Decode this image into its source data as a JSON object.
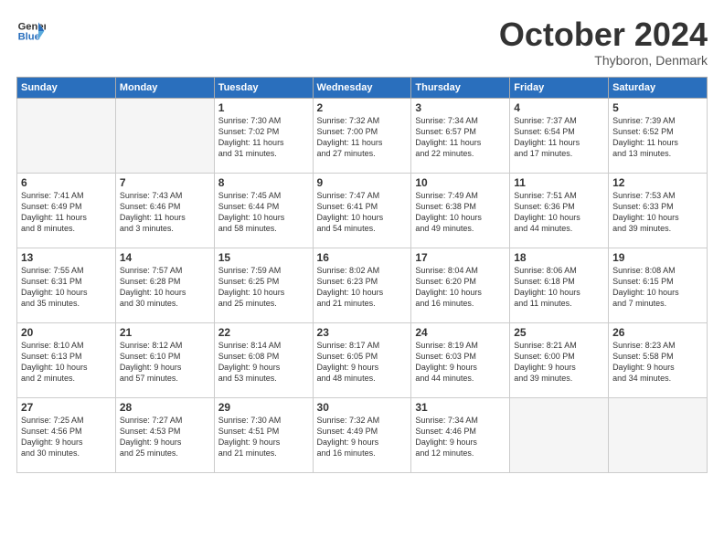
{
  "header": {
    "logo_line1": "General",
    "logo_line2": "Blue",
    "month": "October 2024",
    "location": "Thyboron, Denmark"
  },
  "weekdays": [
    "Sunday",
    "Monday",
    "Tuesday",
    "Wednesday",
    "Thursday",
    "Friday",
    "Saturday"
  ],
  "weeks": [
    [
      {
        "day": "",
        "info": ""
      },
      {
        "day": "",
        "info": ""
      },
      {
        "day": "1",
        "info": "Sunrise: 7:30 AM\nSunset: 7:02 PM\nDaylight: 11 hours\nand 31 minutes."
      },
      {
        "day": "2",
        "info": "Sunrise: 7:32 AM\nSunset: 7:00 PM\nDaylight: 11 hours\nand 27 minutes."
      },
      {
        "day": "3",
        "info": "Sunrise: 7:34 AM\nSunset: 6:57 PM\nDaylight: 11 hours\nand 22 minutes."
      },
      {
        "day": "4",
        "info": "Sunrise: 7:37 AM\nSunset: 6:54 PM\nDaylight: 11 hours\nand 17 minutes."
      },
      {
        "day": "5",
        "info": "Sunrise: 7:39 AM\nSunset: 6:52 PM\nDaylight: 11 hours\nand 13 minutes."
      }
    ],
    [
      {
        "day": "6",
        "info": "Sunrise: 7:41 AM\nSunset: 6:49 PM\nDaylight: 11 hours\nand 8 minutes."
      },
      {
        "day": "7",
        "info": "Sunrise: 7:43 AM\nSunset: 6:46 PM\nDaylight: 11 hours\nand 3 minutes."
      },
      {
        "day": "8",
        "info": "Sunrise: 7:45 AM\nSunset: 6:44 PM\nDaylight: 10 hours\nand 58 minutes."
      },
      {
        "day": "9",
        "info": "Sunrise: 7:47 AM\nSunset: 6:41 PM\nDaylight: 10 hours\nand 54 minutes."
      },
      {
        "day": "10",
        "info": "Sunrise: 7:49 AM\nSunset: 6:38 PM\nDaylight: 10 hours\nand 49 minutes."
      },
      {
        "day": "11",
        "info": "Sunrise: 7:51 AM\nSunset: 6:36 PM\nDaylight: 10 hours\nand 44 minutes."
      },
      {
        "day": "12",
        "info": "Sunrise: 7:53 AM\nSunset: 6:33 PM\nDaylight: 10 hours\nand 39 minutes."
      }
    ],
    [
      {
        "day": "13",
        "info": "Sunrise: 7:55 AM\nSunset: 6:31 PM\nDaylight: 10 hours\nand 35 minutes."
      },
      {
        "day": "14",
        "info": "Sunrise: 7:57 AM\nSunset: 6:28 PM\nDaylight: 10 hours\nand 30 minutes."
      },
      {
        "day": "15",
        "info": "Sunrise: 7:59 AM\nSunset: 6:25 PM\nDaylight: 10 hours\nand 25 minutes."
      },
      {
        "day": "16",
        "info": "Sunrise: 8:02 AM\nSunset: 6:23 PM\nDaylight: 10 hours\nand 21 minutes."
      },
      {
        "day": "17",
        "info": "Sunrise: 8:04 AM\nSunset: 6:20 PM\nDaylight: 10 hours\nand 16 minutes."
      },
      {
        "day": "18",
        "info": "Sunrise: 8:06 AM\nSunset: 6:18 PM\nDaylight: 10 hours\nand 11 minutes."
      },
      {
        "day": "19",
        "info": "Sunrise: 8:08 AM\nSunset: 6:15 PM\nDaylight: 10 hours\nand 7 minutes."
      }
    ],
    [
      {
        "day": "20",
        "info": "Sunrise: 8:10 AM\nSunset: 6:13 PM\nDaylight: 10 hours\nand 2 minutes."
      },
      {
        "day": "21",
        "info": "Sunrise: 8:12 AM\nSunset: 6:10 PM\nDaylight: 9 hours\nand 57 minutes."
      },
      {
        "day": "22",
        "info": "Sunrise: 8:14 AM\nSunset: 6:08 PM\nDaylight: 9 hours\nand 53 minutes."
      },
      {
        "day": "23",
        "info": "Sunrise: 8:17 AM\nSunset: 6:05 PM\nDaylight: 9 hours\nand 48 minutes."
      },
      {
        "day": "24",
        "info": "Sunrise: 8:19 AM\nSunset: 6:03 PM\nDaylight: 9 hours\nand 44 minutes."
      },
      {
        "day": "25",
        "info": "Sunrise: 8:21 AM\nSunset: 6:00 PM\nDaylight: 9 hours\nand 39 minutes."
      },
      {
        "day": "26",
        "info": "Sunrise: 8:23 AM\nSunset: 5:58 PM\nDaylight: 9 hours\nand 34 minutes."
      }
    ],
    [
      {
        "day": "27",
        "info": "Sunrise: 7:25 AM\nSunset: 4:56 PM\nDaylight: 9 hours\nand 30 minutes."
      },
      {
        "day": "28",
        "info": "Sunrise: 7:27 AM\nSunset: 4:53 PM\nDaylight: 9 hours\nand 25 minutes."
      },
      {
        "day": "29",
        "info": "Sunrise: 7:30 AM\nSunset: 4:51 PM\nDaylight: 9 hours\nand 21 minutes."
      },
      {
        "day": "30",
        "info": "Sunrise: 7:32 AM\nSunset: 4:49 PM\nDaylight: 9 hours\nand 16 minutes."
      },
      {
        "day": "31",
        "info": "Sunrise: 7:34 AM\nSunset: 4:46 PM\nDaylight: 9 hours\nand 12 minutes."
      },
      {
        "day": "",
        "info": ""
      },
      {
        "day": "",
        "info": ""
      }
    ]
  ]
}
